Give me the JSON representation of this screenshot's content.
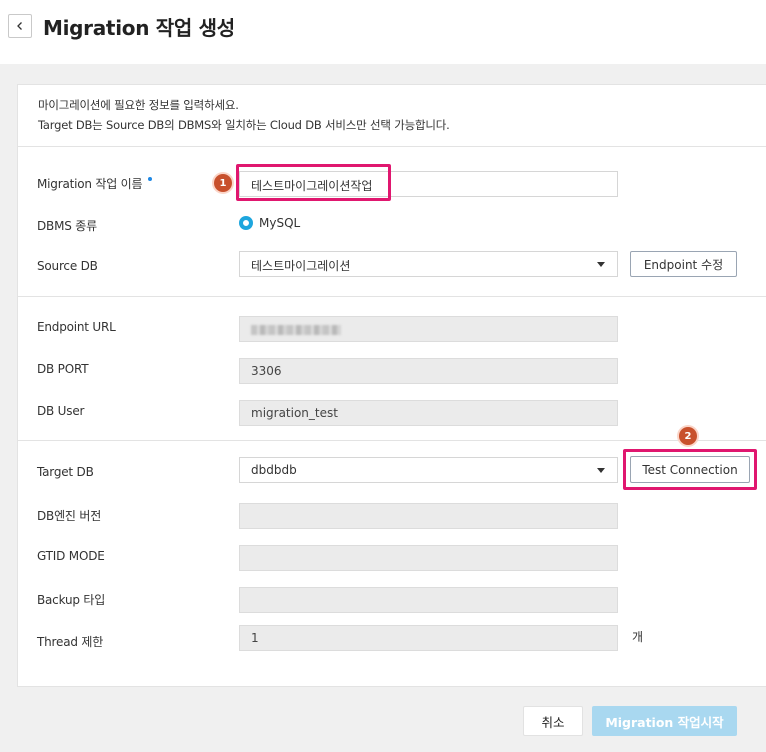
{
  "header": {
    "title": "Migration 작업 생성",
    "back_icon": "chevron-left-icon"
  },
  "info": {
    "line1": "마이그레이션에 필요한 정보를 입력하세요.",
    "line2": "Target DB는 Source DB의 DBMS와 일치하는 Cloud DB 서비스만 선택 가능합니다."
  },
  "form": {
    "migration_name": {
      "label": "Migration 작업 이름",
      "value": "테스트마이그레이션작업"
    },
    "dbms_type": {
      "label": "DBMS 종류",
      "selected": "MySQL"
    },
    "source_db": {
      "label": "Source DB",
      "value": "테스트마이그레이션",
      "edit_button": "Endpoint 수정"
    },
    "endpoint_url": {
      "label": "Endpoint URL",
      "value": ""
    },
    "db_port": {
      "label": "DB PORT",
      "value": "3306"
    },
    "db_user": {
      "label": "DB User",
      "value": "migration_test"
    },
    "target_db": {
      "label": "Target DB",
      "value": "dbdbdb",
      "test_button": "Test Connection"
    },
    "db_engine_version": {
      "label": "DB엔진 버전",
      "value": ""
    },
    "gtid_mode": {
      "label": "GTID MODE",
      "value": ""
    },
    "backup_type": {
      "label": "Backup 타입",
      "value": ""
    },
    "thread_limit": {
      "label": "Thread 제한",
      "value": "1",
      "unit": "개"
    }
  },
  "annotations": {
    "step1": "1",
    "step2": "2"
  },
  "footer": {
    "cancel": "취소",
    "start": "Migration 작업시작"
  },
  "colors": {
    "accent": "#1ea6de",
    "highlight": "#e0176f",
    "badge": "#c8502c",
    "start_button": "#a9d8f0"
  }
}
